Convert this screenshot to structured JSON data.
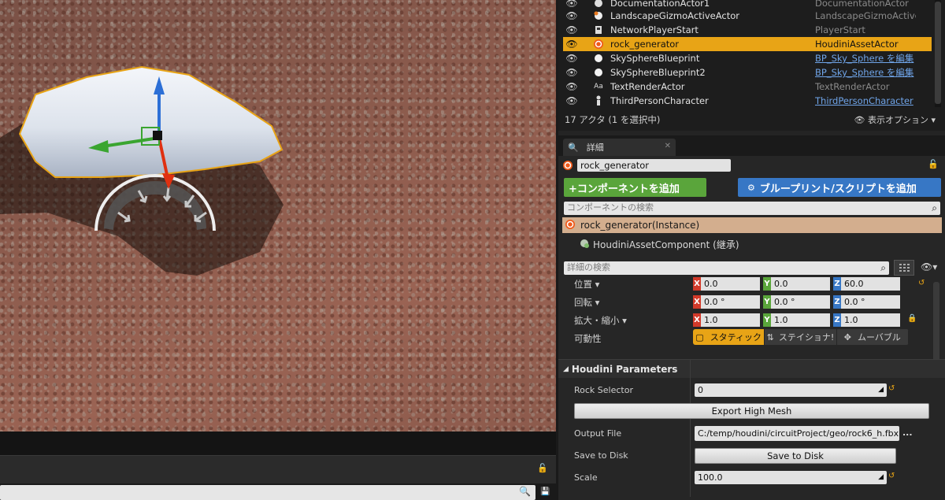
{
  "outliner": {
    "rows": [
      {
        "name": "DocumentationActor1",
        "type": "DocumentationActor",
        "icon": "documentation-icon"
      },
      {
        "name": "LandscapeGizmoActiveActor",
        "type": "LandscapeGizmoActiveA",
        "icon": "landscape-gizmo-icon"
      },
      {
        "name": "NetworkPlayerStart",
        "type": "PlayerStart",
        "icon": "player-start-icon"
      },
      {
        "name": "rock_generator",
        "type": "HoudiniAssetActor",
        "icon": "houdini-icon"
      },
      {
        "name": "SkySphereBlueprint",
        "type": "BP_Sky_Sphere を編集",
        "icon": "sphere-icon"
      },
      {
        "name": "SkySphereBlueprint2",
        "type": "BP_Sky_Sphere を編集",
        "icon": "sphere-icon"
      },
      {
        "name": "TextRenderActor",
        "type": "TextRenderActor",
        "icon": "text-render-icon"
      },
      {
        "name": "ThirdPersonCharacter",
        "type": "ThirdPersonCharacter",
        "icon": "character-icon"
      }
    ],
    "footer": "17 アクタ (1 を選択中)",
    "view_options": "表示オプション"
  },
  "details": {
    "tab_label": "詳細",
    "actor_name": "rock_generator",
    "add_component": "+コンポーネントを追加",
    "blueprint_script": "ブループリント/スクリプトを追加",
    "component_search_placeholder": "コンポーネントの検索",
    "instance": "rock_generator(Instance)",
    "houdini_component": "HoudiniAssetComponent (継承)",
    "details_search_placeholder": "詳細の検索",
    "transform": {
      "location_label": "位置",
      "rotation_label": "回転",
      "scale_label": "拡大・縮小",
      "location": {
        "x": "0.0",
        "y": "0.0",
        "z": "60.0"
      },
      "rotation": {
        "x": "0.0 °",
        "y": "0.0 °",
        "z": "0.0 °"
      },
      "scale": {
        "x": "1.0",
        "y": "1.0",
        "z": "1.0"
      },
      "axis_x": "X",
      "axis_y": "Y",
      "axis_z": "Z"
    },
    "mobility": {
      "label": "可動性",
      "static": "スタティック",
      "stationary": "ステイショナ!",
      "movable": "ムーバブル"
    },
    "houdini": {
      "header": "Houdini Parameters",
      "rock_selector_label": "Rock Selector",
      "rock_selector_value": "0",
      "export_button": "Export High Mesh",
      "output_file_label": "Output File",
      "output_file_value": "C:/temp/houdini/circuitProject/geo/rock6_h.fbx",
      "output_file_more": "...",
      "save_to_disk_label": "Save to Disk",
      "save_to_disk_button": "Save to Disk",
      "scale_label": "Scale",
      "scale_value": "100.0"
    }
  },
  "colors": {
    "selection": "#e8a416",
    "add_component": "#5aa53b",
    "blueprint": "#3777c5",
    "instance_row": "#d3ae8e",
    "axis_x": "#d23a2a",
    "axis_y": "#5aa53b",
    "axis_z": "#3777c5"
  }
}
